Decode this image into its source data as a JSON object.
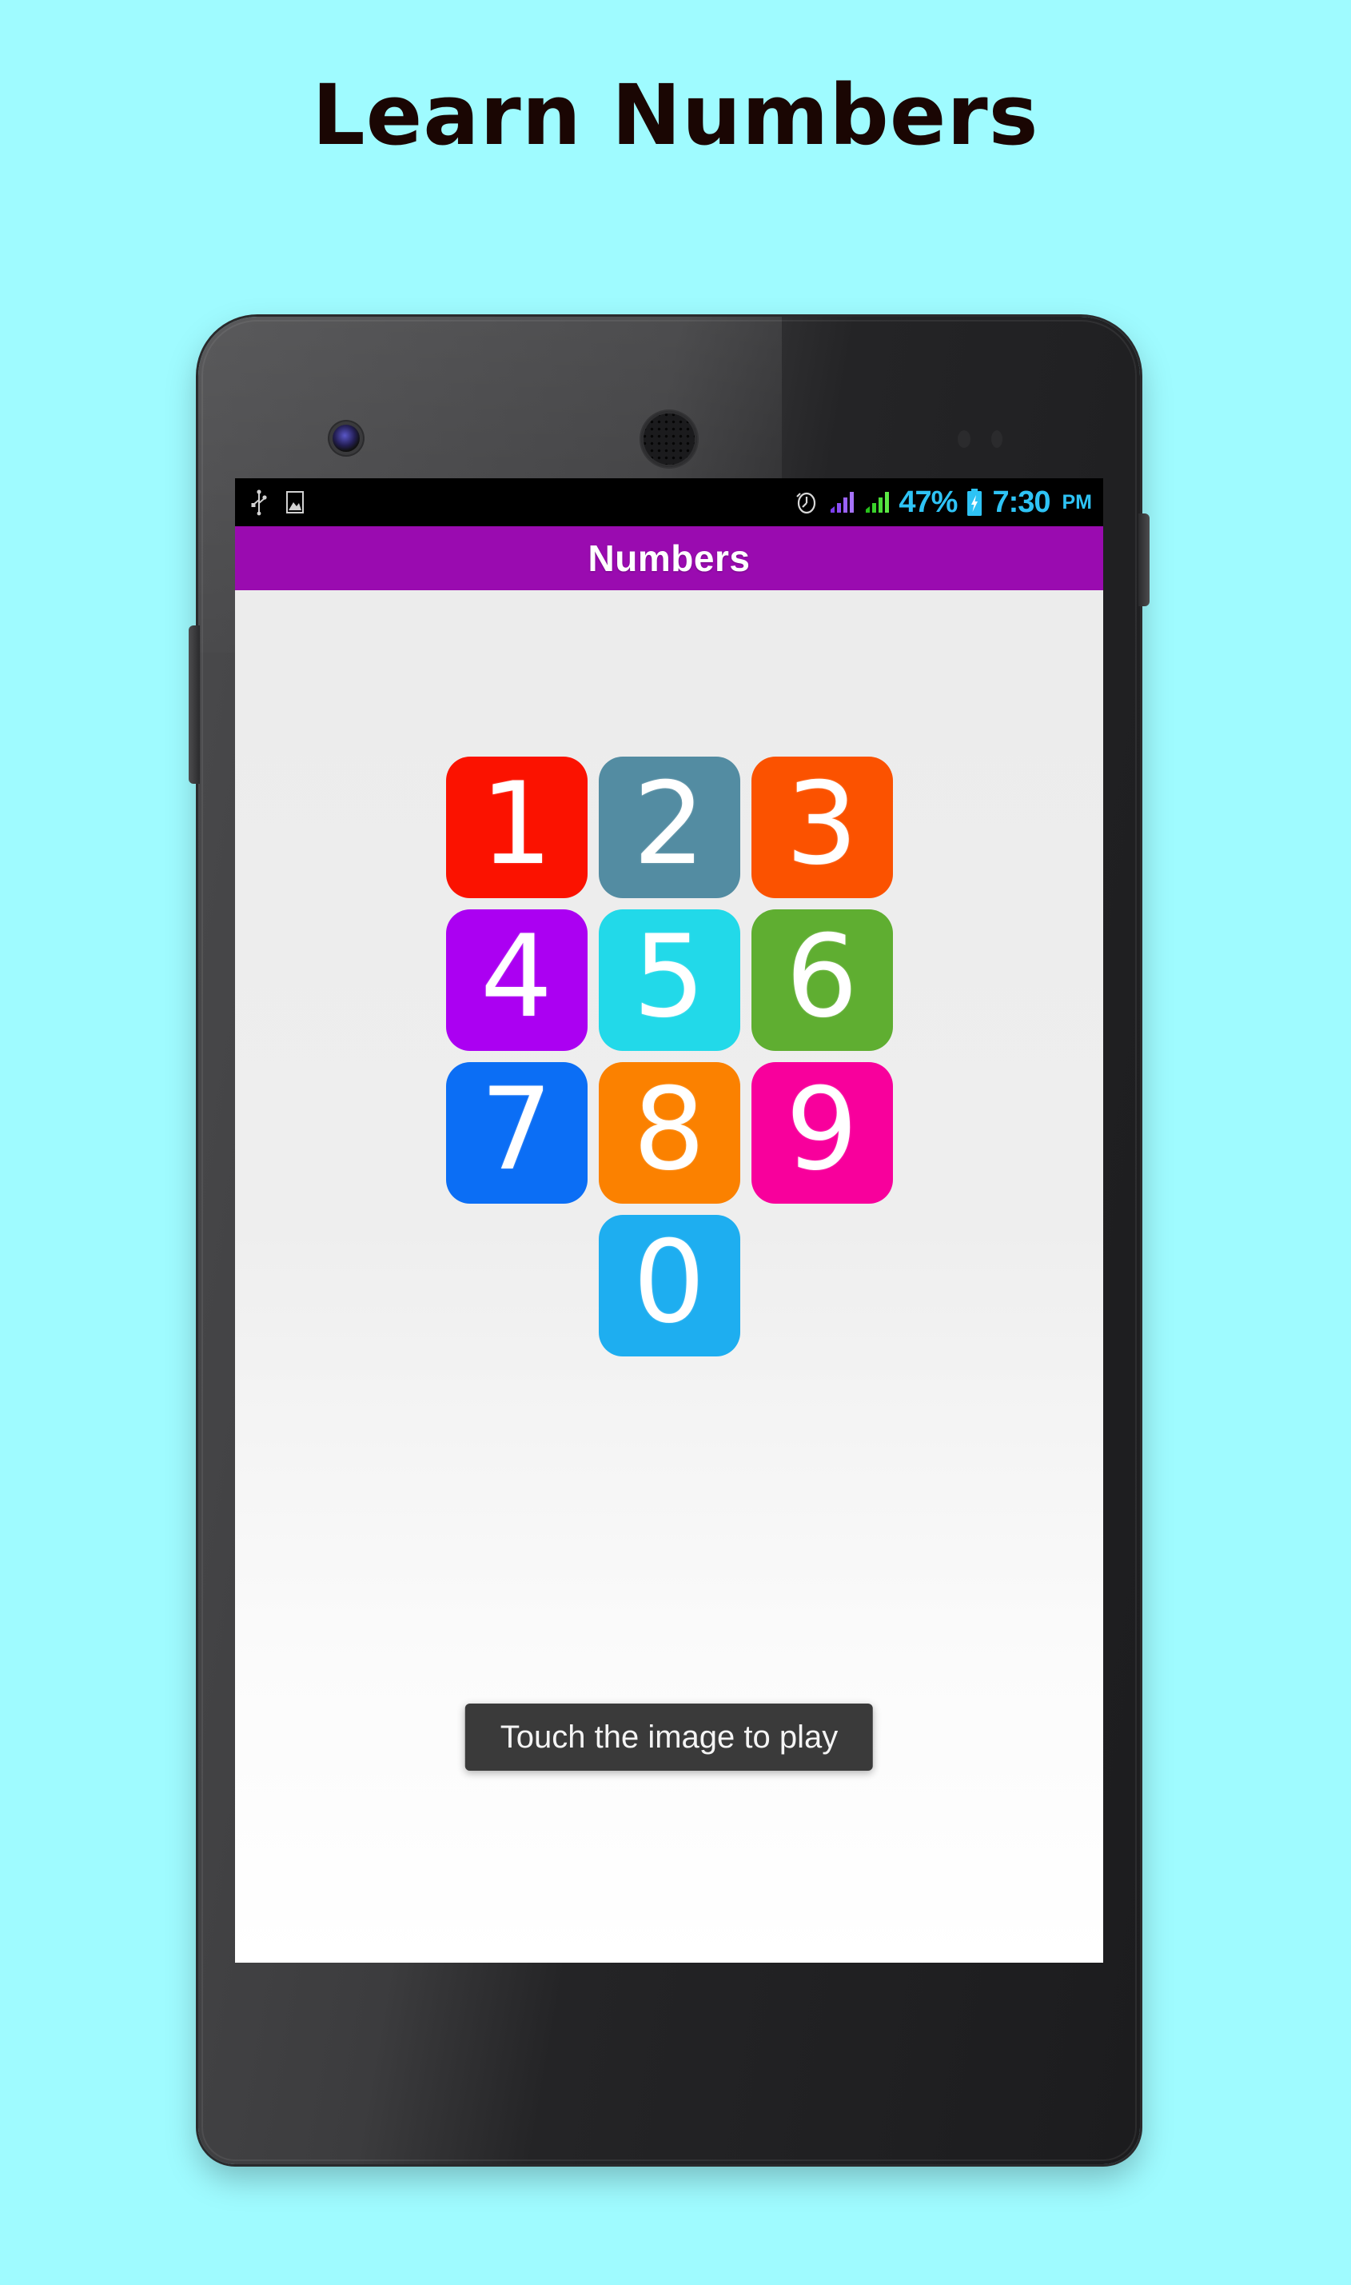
{
  "page": {
    "background_color": "#9ffbff",
    "banner_title": "Learn Numbers"
  },
  "phone": {
    "hardware": {
      "front_camera": "front-camera",
      "earpiece": "earpiece-speaker",
      "proximity_sensor": "proximity-sensor",
      "volume_button": "volume-rocker",
      "power_button": "power-button"
    }
  },
  "statusbar": {
    "left_icons": [
      "usb-icon",
      "photo-icon"
    ],
    "right_icons": [
      "alarm-icon",
      "signal-icon-1",
      "signal-icon-2",
      "battery-icon"
    ],
    "battery_percent": "47%",
    "time": "7:30",
    "ampm": "PM",
    "text_color": "#2ec3f5",
    "background_color": "#000000"
  },
  "app": {
    "actionbar": {
      "title": "Numbers",
      "background_color": "#9a0bb0",
      "title_color": "#ffffff"
    },
    "grid": {
      "tiles": [
        {
          "label": "1",
          "color": "#fb1200"
        },
        {
          "label": "2",
          "color": "#538ca2"
        },
        {
          "label": "3",
          "color": "#fb5200"
        },
        {
          "label": "4",
          "color": "#ab00f2"
        },
        {
          "label": "5",
          "color": "#22d9e9"
        },
        {
          "label": "6",
          "color": "#5fae31"
        },
        {
          "label": "7",
          "color": "#0b6ef5"
        },
        {
          "label": "8",
          "color": "#fb8100"
        },
        {
          "label": "9",
          "color": "#f8009c"
        },
        {
          "label": "0",
          "color": "#1eaef0"
        }
      ]
    },
    "toast": {
      "message": "Touch the image to play",
      "background_color": "#3a3a3a",
      "text_color": "#f4f4f4"
    }
  }
}
